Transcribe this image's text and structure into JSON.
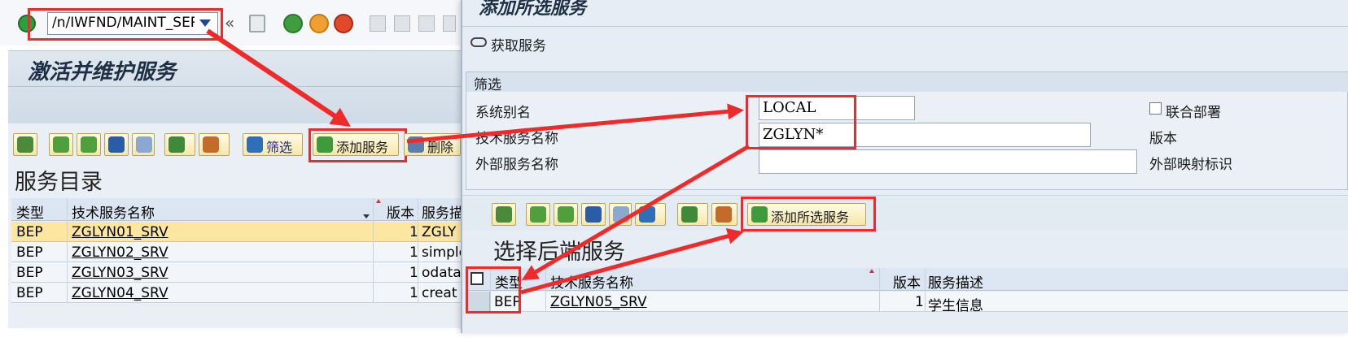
{
  "top_toolbar": {
    "command_field_value": "/n/IWFND/MAINT_SER"
  },
  "left_window": {
    "title": "激活并维护服务",
    "buttons": {
      "filter": "筛选",
      "add_service": "添加服务",
      "delete": "删除"
    },
    "section_title": "服务目录",
    "columns": [
      "类型",
      "技术服务名称",
      "版本",
      "服务描述"
    ],
    "rows": [
      {
        "type": "BEP",
        "name": "ZGLYN01_SRV",
        "version": "1",
        "desc": "ZGLY"
      },
      {
        "type": "BEP",
        "name": "ZGLYN02_SRV",
        "version": "1",
        "desc": "simple"
      },
      {
        "type": "BEP",
        "name": "ZGLYN03_SRV",
        "version": "1",
        "desc": "odata"
      },
      {
        "type": "BEP",
        "name": "ZGLYN04_SRV",
        "version": "1",
        "desc": "creat"
      }
    ]
  },
  "right_window": {
    "title": "添加所选服务",
    "get_services_label": "获取服务",
    "filter_group": {
      "title": "筛选",
      "system_alias_label": "系统别名",
      "system_alias_value": "LOCAL",
      "tech_service_label": "技术服务名称",
      "tech_service_value": "ZGLYN*",
      "external_service_label": "外部服务名称",
      "external_service_value": "",
      "co_deploy_label": "联合部署",
      "version_label": "版本",
      "external_mapping_label": "外部映射标识"
    },
    "add_selected_button": "添加所选服务",
    "section_title": "选择后端服务",
    "columns": [
      "类型",
      "技术服务名称",
      "版本",
      "服务描述"
    ],
    "rows": [
      {
        "type": "BEP",
        "name": "ZGLYN05_SRV",
        "version": "1",
        "desc": "学生信息"
      }
    ]
  },
  "colors": {
    "annotation_red": "#ee2a2a",
    "selected_row": "#fde7a0",
    "header_blue": "#dbe6f2"
  }
}
